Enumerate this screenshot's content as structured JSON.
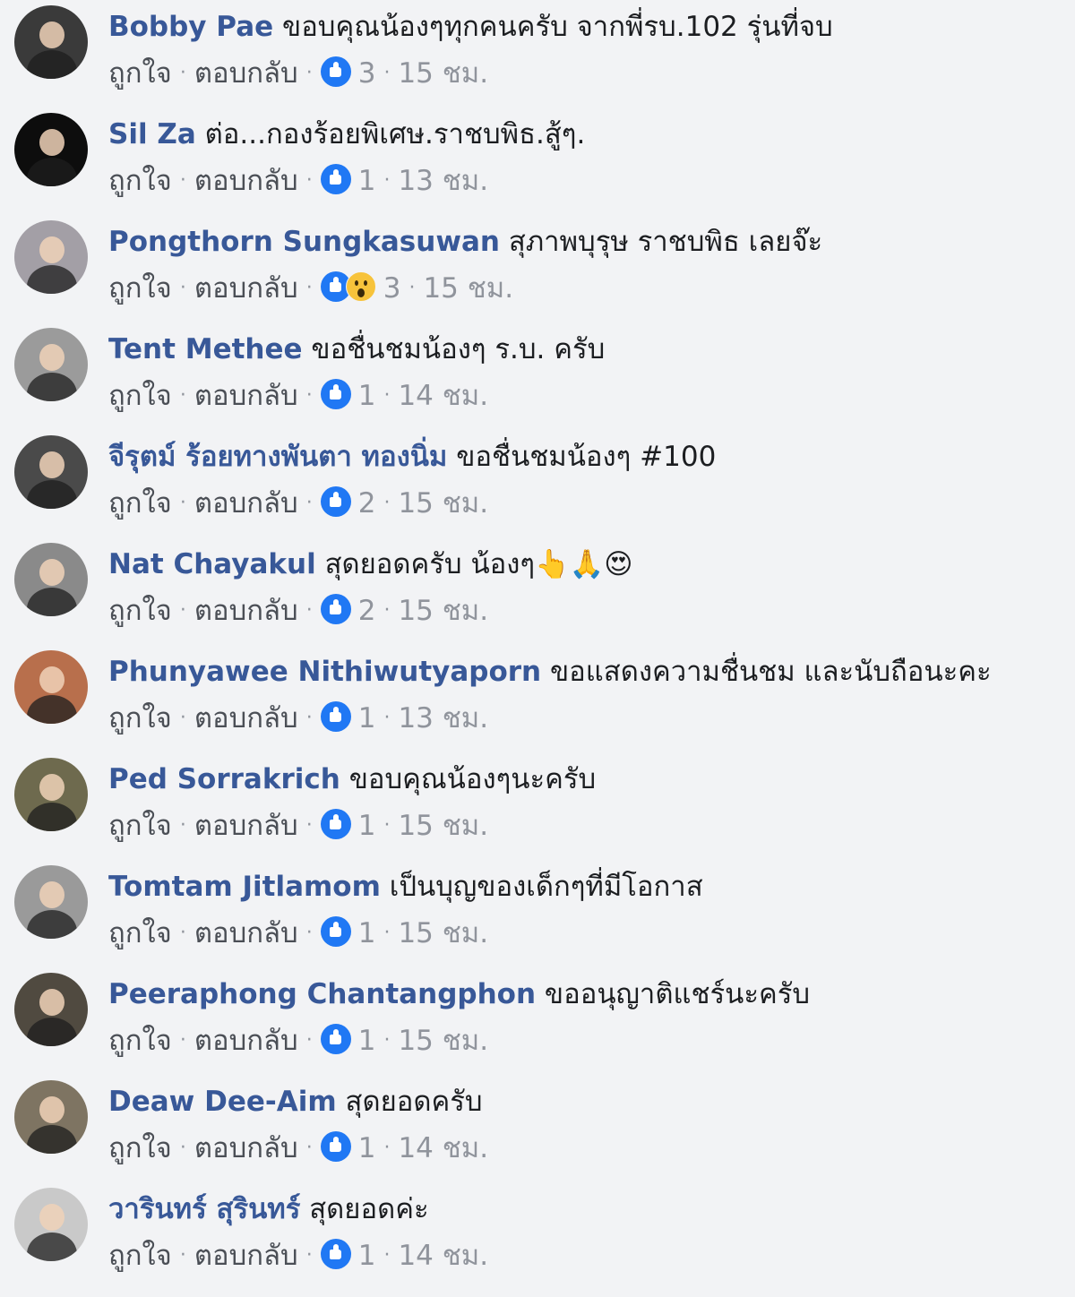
{
  "actions": {
    "like": "ถูกใจ",
    "reply": "ตอบกลับ"
  },
  "colors": {
    "author": "#385898",
    "like_badge": "#2078f4",
    "meta": "#90949c",
    "background": "#f2f3f5"
  },
  "comments": [
    {
      "author": "Bobby Pae",
      "text": "ขอบคุณน้องๆทุกคนครับ จากพี่รบ.102 รุ่นที่จบ",
      "reactions": [
        "like-icon"
      ],
      "count": "3",
      "time": "15 ชม.",
      "avatar_color": "#3a3a3a"
    },
    {
      "author": "Sil Za",
      "text": "ต่อ...กองร้อยพิเศษ.ราชบพิธ.สู้ๆ.",
      "reactions": [
        "like-icon"
      ],
      "count": "1",
      "time": "13 ชม.",
      "avatar_color": "#0d0d0d"
    },
    {
      "author": "Pongthorn Sungkasuwan",
      "text": "สุภาพบุรุษ ราชบพิธ เลยจ๊ะ",
      "reactions": [
        "like-icon",
        "wow-icon"
      ],
      "count": "3",
      "time": "15 ชม.",
      "avatar_color": "#a39fa6"
    },
    {
      "author": "Tent Methee",
      "text": "ขอชื่นชมน้องๆ ร.บ. ครับ",
      "reactions": [
        "like-icon"
      ],
      "count": "1",
      "time": "14 ชม.",
      "avatar_color": "#9b9b9b"
    },
    {
      "author": "จีรุตม์ ร้อยทางพันตา ทองนิ่ม",
      "text": "ขอชื่นชมน้องๆ #100",
      "reactions": [
        "like-icon"
      ],
      "count": "2",
      "time": "15 ชม.",
      "avatar_color": "#4a4a4a"
    },
    {
      "author": "Nat Chayakul",
      "text": "สุดยอดครับ น้องๆ👆🙏😍",
      "reactions": [
        "like-icon"
      ],
      "count": "2",
      "time": "15 ชม.",
      "avatar_color": "#8a8a8a"
    },
    {
      "author": "Phunyawee Nithiwutyaporn",
      "text": "ขอแสดงความชื่นชม และนับถือนะคะ",
      "reactions": [
        "like-icon"
      ],
      "count": "1",
      "time": "13 ชม.",
      "avatar_color": "#b86f4c"
    },
    {
      "author": "Ped Sorrakrich",
      "text": "ขอบคุณน้องๆนะครับ",
      "reactions": [
        "like-icon"
      ],
      "count": "1",
      "time": "15 ชม.",
      "avatar_color": "#6e6a4e"
    },
    {
      "author": "Tomtam Jitlamom",
      "text": "เป็นบุญของเด็กๆที่มีโอกาส",
      "reactions": [
        "like-icon"
      ],
      "count": "1",
      "time": "15 ชม.",
      "avatar_color": "#9a9a9a"
    },
    {
      "author": "Peeraphong Chantangphon",
      "text": "ขออนุญาติแชร์นะครับ",
      "reactions": [
        "like-icon"
      ],
      "count": "1",
      "time": "15 ชม.",
      "avatar_color": "#504a40"
    },
    {
      "author": "Deaw Dee-Aim",
      "text": "สุดยอดครับ",
      "reactions": [
        "like-icon"
      ],
      "count": "1",
      "time": "14 ชม.",
      "avatar_color": "#7e7462"
    },
    {
      "author": "วารินทร์ สุรินทร์",
      "text": "สุดยอดค่ะ",
      "reactions": [
        "like-icon"
      ],
      "count": "1",
      "time": "14 ชม.",
      "avatar_color": "#c9c9c9"
    }
  ]
}
